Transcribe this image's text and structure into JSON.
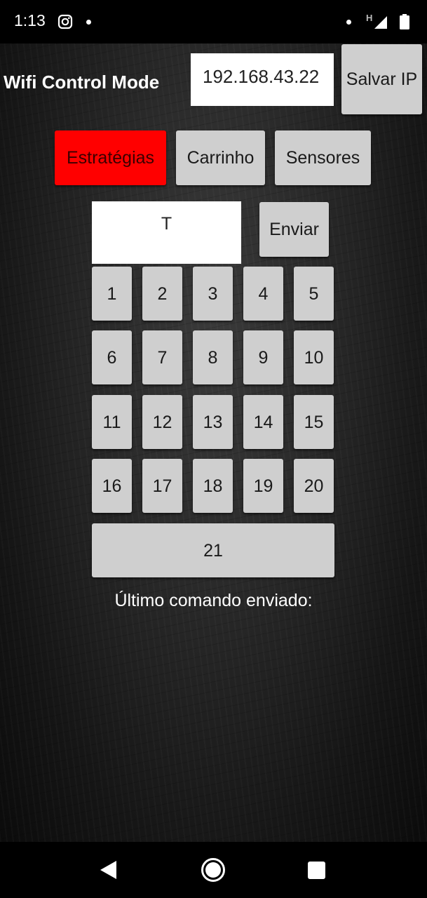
{
  "status_bar": {
    "time": "1:13",
    "signal_label": "H",
    "icons": [
      "instagram-icon",
      "notification-dot-icon",
      "signal-icon",
      "battery-icon"
    ]
  },
  "header": {
    "title": "Wifi Control Mode",
    "ip_value": "192.168.43.22",
    "save_ip_label": "Salvar IP"
  },
  "tabs": [
    {
      "label": "Estratégias",
      "active": true,
      "color": "#ff0000"
    },
    {
      "label": "Carrinho",
      "active": false
    },
    {
      "label": "Sensores",
      "active": false
    }
  ],
  "command": {
    "value": "T",
    "send_label": "Enviar"
  },
  "keypad": [
    "1",
    "2",
    "3",
    "4",
    "5",
    "6",
    "7",
    "8",
    "9",
    "10",
    "11",
    "12",
    "13",
    "14",
    "15",
    "16",
    "17",
    "18",
    "19",
    "20",
    "21"
  ],
  "last_command_label": "Último comando enviado:",
  "nav_bar": {
    "icons": [
      "back-icon",
      "home-icon",
      "recents-icon"
    ]
  },
  "colors": {
    "button_gray": "#cfcfcf",
    "active_tab": "#ff0000",
    "background": "#2a2a2a"
  }
}
